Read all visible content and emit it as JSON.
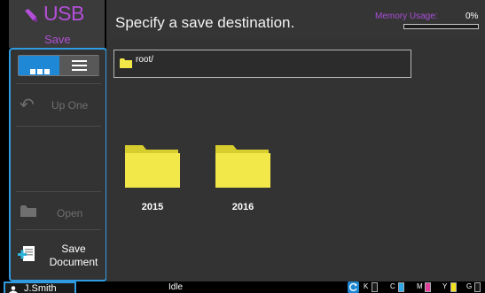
{
  "app": {
    "title": "USB",
    "subtitle": "Save",
    "icon": "usb-pen-icon",
    "color": "#b34fd8"
  },
  "header": {
    "title": "Specify a save destination.",
    "memory_label": "Memory Usage:",
    "memory_value": "0%",
    "memory_fraction": 0
  },
  "sidebar": {
    "view_icons_icon": "grid-view-icon",
    "view_list_icon": "list-view-icon",
    "up_one_label": "Up One",
    "open_label": "Open",
    "save_line1": "Save",
    "save_line2": "Document"
  },
  "path": {
    "text": "root/"
  },
  "folders": [
    {
      "name": "2015"
    },
    {
      "name": "2016"
    }
  ],
  "footer": {
    "user": "J.Smith",
    "status": "Idle",
    "inks": [
      {
        "label": "K",
        "color": "#1a1a1a"
      },
      {
        "label": "C",
        "color": "#2ea8e6"
      },
      {
        "label": "M",
        "color": "#e0409a"
      },
      {
        "label": "Y",
        "color": "#f2e21c"
      },
      {
        "label": "G",
        "color": "#1a1a1a"
      }
    ]
  },
  "colors": {
    "accent": "#2f9be0",
    "folder": "#f3e84a"
  }
}
